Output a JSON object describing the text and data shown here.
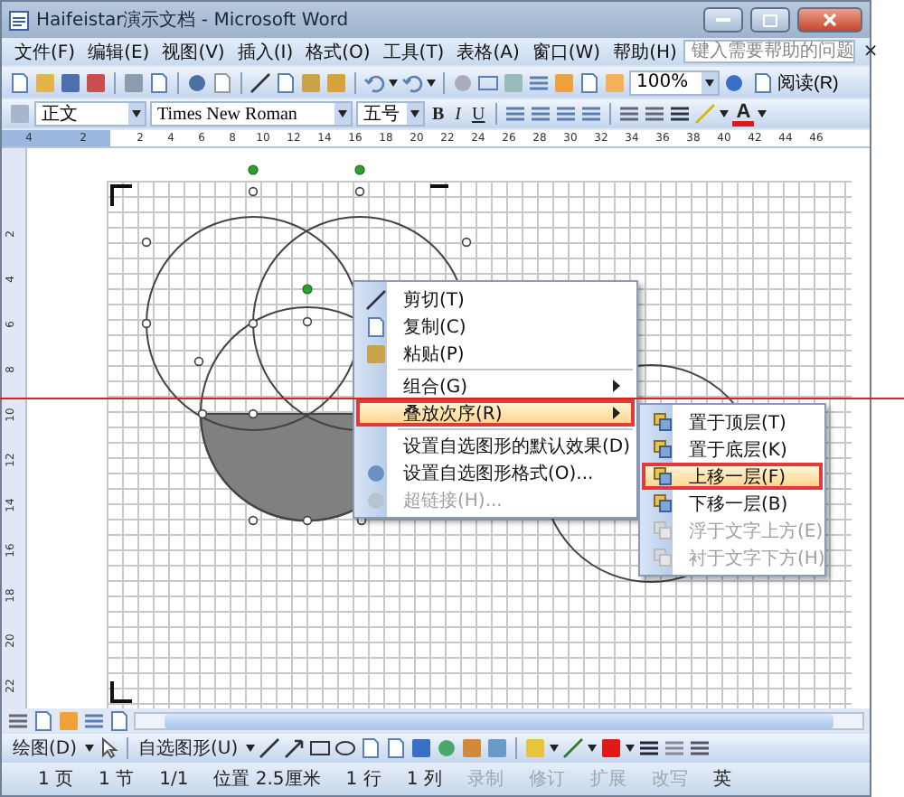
{
  "window": {
    "title": "Haifeistar演示文档 - Microsoft Word"
  },
  "menu_bar": {
    "items": [
      "文件(F)",
      "编辑(E)",
      "视图(V)",
      "插入(I)",
      "格式(O)",
      "工具(T)",
      "表格(A)",
      "窗口(W)",
      "帮助(H)"
    ],
    "help_placeholder": "键入需要帮助的问题",
    "close": "×"
  },
  "standard_toolbar": {
    "zoom": "100%",
    "read_button": "阅读(R)"
  },
  "format_toolbar": {
    "style": "正文",
    "font": "Times New Roman",
    "size": "五号",
    "buttons": [
      "B",
      "I",
      "U"
    ],
    "font_color": "A"
  },
  "ruler": {
    "left_labels": [
      "4",
      "2"
    ],
    "labels": [
      "2",
      "4",
      "6",
      "8",
      "10",
      "12",
      "14",
      "16",
      "18",
      "20",
      "22",
      "24",
      "26",
      "28",
      "30",
      "32",
      "34",
      "36",
      "38",
      "40",
      "42",
      "44",
      "46"
    ],
    "vertical_labels": [
      "2",
      "4",
      "6",
      "8",
      "10",
      "12",
      "14",
      "16",
      "18",
      "20",
      "22"
    ]
  },
  "context_menu": {
    "items": [
      {
        "kind": "command",
        "label": "剪切(T)",
        "selected": false,
        "disabled": false,
        "submenu": false
      },
      {
        "kind": "command",
        "label": "复制(C)",
        "selected": false,
        "disabled": false,
        "submenu": false
      },
      {
        "kind": "command",
        "label": "粘贴(P)",
        "selected": false,
        "disabled": false,
        "submenu": false
      },
      {
        "kind": "separator"
      },
      {
        "kind": "command",
        "label": "组合(G)",
        "selected": false,
        "disabled": false,
        "submenu": true
      },
      {
        "kind": "command",
        "label": "叠放次序(R)",
        "selected": true,
        "disabled": false,
        "submenu": true
      },
      {
        "kind": "separator"
      },
      {
        "kind": "command",
        "label": "设置自选图形的默认效果(D)",
        "selected": false,
        "disabled": false,
        "submenu": false
      },
      {
        "kind": "command",
        "label": "设置自选图形格式(O)...",
        "selected": false,
        "disabled": false,
        "submenu": false
      },
      {
        "kind": "command",
        "label": "超链接(H)...",
        "selected": false,
        "disabled": true,
        "submenu": false
      }
    ]
  },
  "submenu": {
    "items": [
      {
        "label": "置于顶层(T)",
        "selected": false,
        "disabled": false
      },
      {
        "label": "置于底层(K)",
        "selected": false,
        "disabled": false
      },
      {
        "label": "上移一层(F)",
        "selected": true,
        "disabled": false
      },
      {
        "label": "下移一层(B)",
        "selected": false,
        "disabled": false
      },
      {
        "label": "浮于文字上方(E)",
        "selected": false,
        "disabled": true
      },
      {
        "label": "衬于文字下方(H)",
        "selected": false,
        "disabled": true
      }
    ]
  },
  "drawing_toolbar": {
    "draw": "绘图(D)",
    "autoshapes": "自选图形(U)"
  },
  "status_bar": {
    "items": [
      {
        "text": "1 页",
        "disabled": false
      },
      {
        "text": "1 节",
        "disabled": false
      },
      {
        "text": "1/1",
        "disabled": false
      },
      {
        "text": "位置 2.5厘米",
        "disabled": false
      },
      {
        "text": "1 行",
        "disabled": false
      },
      {
        "text": "1 列",
        "disabled": false
      },
      {
        "text": "录制",
        "disabled": true
      },
      {
        "text": "修订",
        "disabled": true
      },
      {
        "text": "扩展",
        "disabled": true
      },
      {
        "text": "改写",
        "disabled": true
      },
      {
        "text": "英",
        "disabled": false
      }
    ]
  }
}
